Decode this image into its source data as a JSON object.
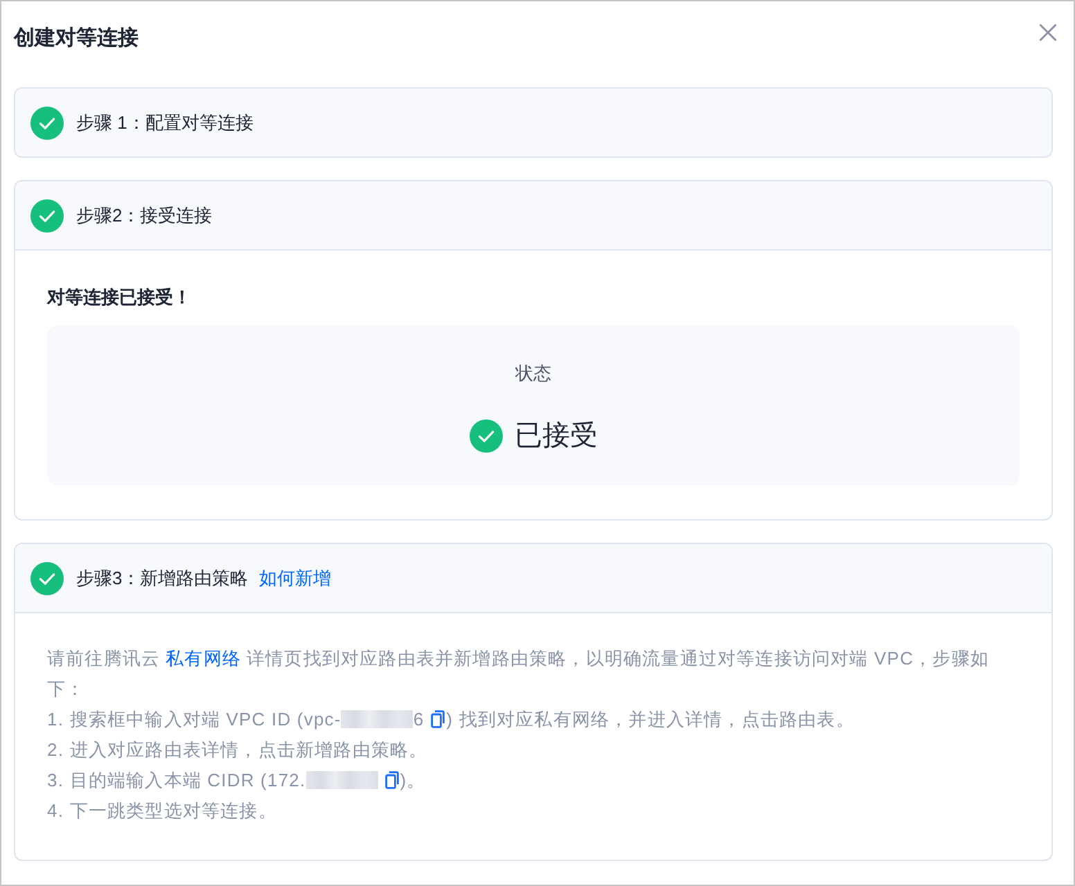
{
  "dialog": {
    "title": "创建对等连接"
  },
  "steps": [
    {
      "kind": "plain",
      "title": "步骤 1：配置对等连接",
      "completed": true
    },
    {
      "kind": "status",
      "title": "步骤2：接受连接",
      "completed": true,
      "heading": "对等连接已接受！",
      "status": {
        "label": "状态",
        "value": "已接受"
      }
    },
    {
      "kind": "instructions",
      "title": "步骤3：新增路由策略",
      "help_link": "如何新增",
      "completed": true,
      "intro": {
        "before": "请前往腾讯云",
        "link": "私有网络",
        "after": "详情页找到对应路由表并新增路由策略，以明确流量通过对等连接访问对端 VPC，步骤如下："
      },
      "items": [
        [
          {
            "kind": "text",
            "text": "1. 搜索框中输入对端 VPC ID (vpc-"
          },
          {
            "kind": "redacted"
          },
          {
            "kind": "text",
            "text": "6"
          },
          {
            "kind": "copy_icon"
          },
          {
            "kind": "text",
            "text": ") 找到对应私有网络，并进入详情，点击路由表。"
          }
        ],
        [
          {
            "kind": "text",
            "text": "2. 进入对应路由表详情，点击新增路由策略。"
          }
        ],
        [
          {
            "kind": "text",
            "text": "3. 目的端输入本端 CIDR (172."
          },
          {
            "kind": "redacted"
          },
          {
            "kind": "copy_icon"
          },
          {
            "kind": "text",
            "text": ")。"
          }
        ],
        [
          {
            "kind": "text",
            "text": "4. 下一跳类型选对等连接。"
          }
        ]
      ]
    }
  ]
}
